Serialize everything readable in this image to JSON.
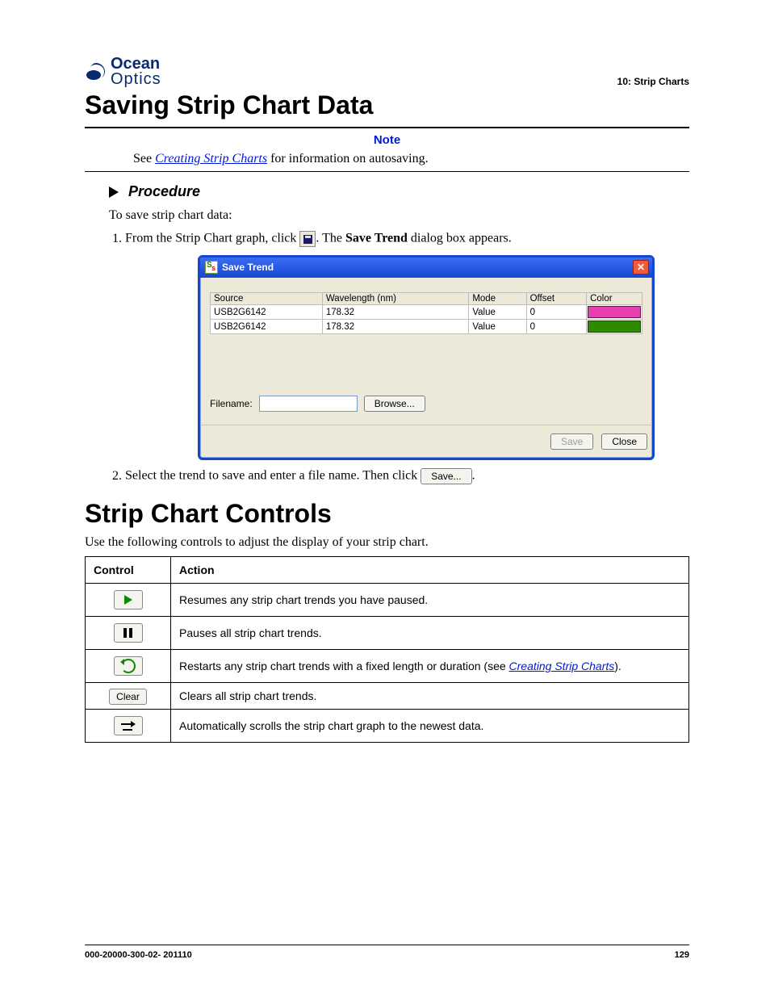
{
  "logo": {
    "line1": "Ocean",
    "line2": "Optics"
  },
  "chapter": "10: Strip Charts",
  "heading1": "Saving Strip Chart Data",
  "note": {
    "label": "Note",
    "prefix": "See ",
    "link": "Creating Strip Charts",
    "suffix": " for information on autosaving."
  },
  "procedure": {
    "label": "Procedure",
    "intro": "To save strip chart data:",
    "step1": {
      "pre": "From the Strip Chart graph, click ",
      "mid": ". The ",
      "bold": "Save Trend",
      "post": " dialog box appears."
    },
    "step2": {
      "pre": "Select the trend to save and enter a file name. Then click ",
      "btn": "Save...",
      "post": "."
    }
  },
  "dialog": {
    "title": "Save Trend",
    "cols": [
      "Source",
      "Wavelength (nm)",
      "Mode",
      "Offset",
      "Color"
    ],
    "rows": [
      {
        "source": "USB2G6142",
        "wavelength": "178.32",
        "mode": "Value",
        "offset": "0",
        "color": "#e83fb0"
      },
      {
        "source": "USB2G6142",
        "wavelength": "178.32",
        "mode": "Value",
        "offset": "0",
        "color": "#2e8b00"
      }
    ],
    "filename_label": "Filename:",
    "browse": "Browse...",
    "save": "Save",
    "close": "Close"
  },
  "heading2": "Strip Chart Controls",
  "controls_intro": "Use the following controls to adjust the display of your strip chart.",
  "controls": {
    "col1": "Control",
    "col2": "Action",
    "rows": [
      {
        "icon": "play",
        "text": "Resumes any strip chart trends you have paused."
      },
      {
        "icon": "pause",
        "text": "Pauses all strip chart trends."
      },
      {
        "icon": "reload",
        "text_pre": "Restarts any strip chart trends with a fixed length or duration (see ",
        "link": "Creating Strip Charts",
        "text_post": ")."
      },
      {
        "icon": "clear",
        "label": "Clear",
        "text": "Clears all strip chart trends."
      },
      {
        "icon": "scroll",
        "text": "Automatically scrolls the strip chart graph to the newest data."
      }
    ]
  },
  "footer": {
    "left": "000-20000-300-02- 201110",
    "right": "129"
  }
}
